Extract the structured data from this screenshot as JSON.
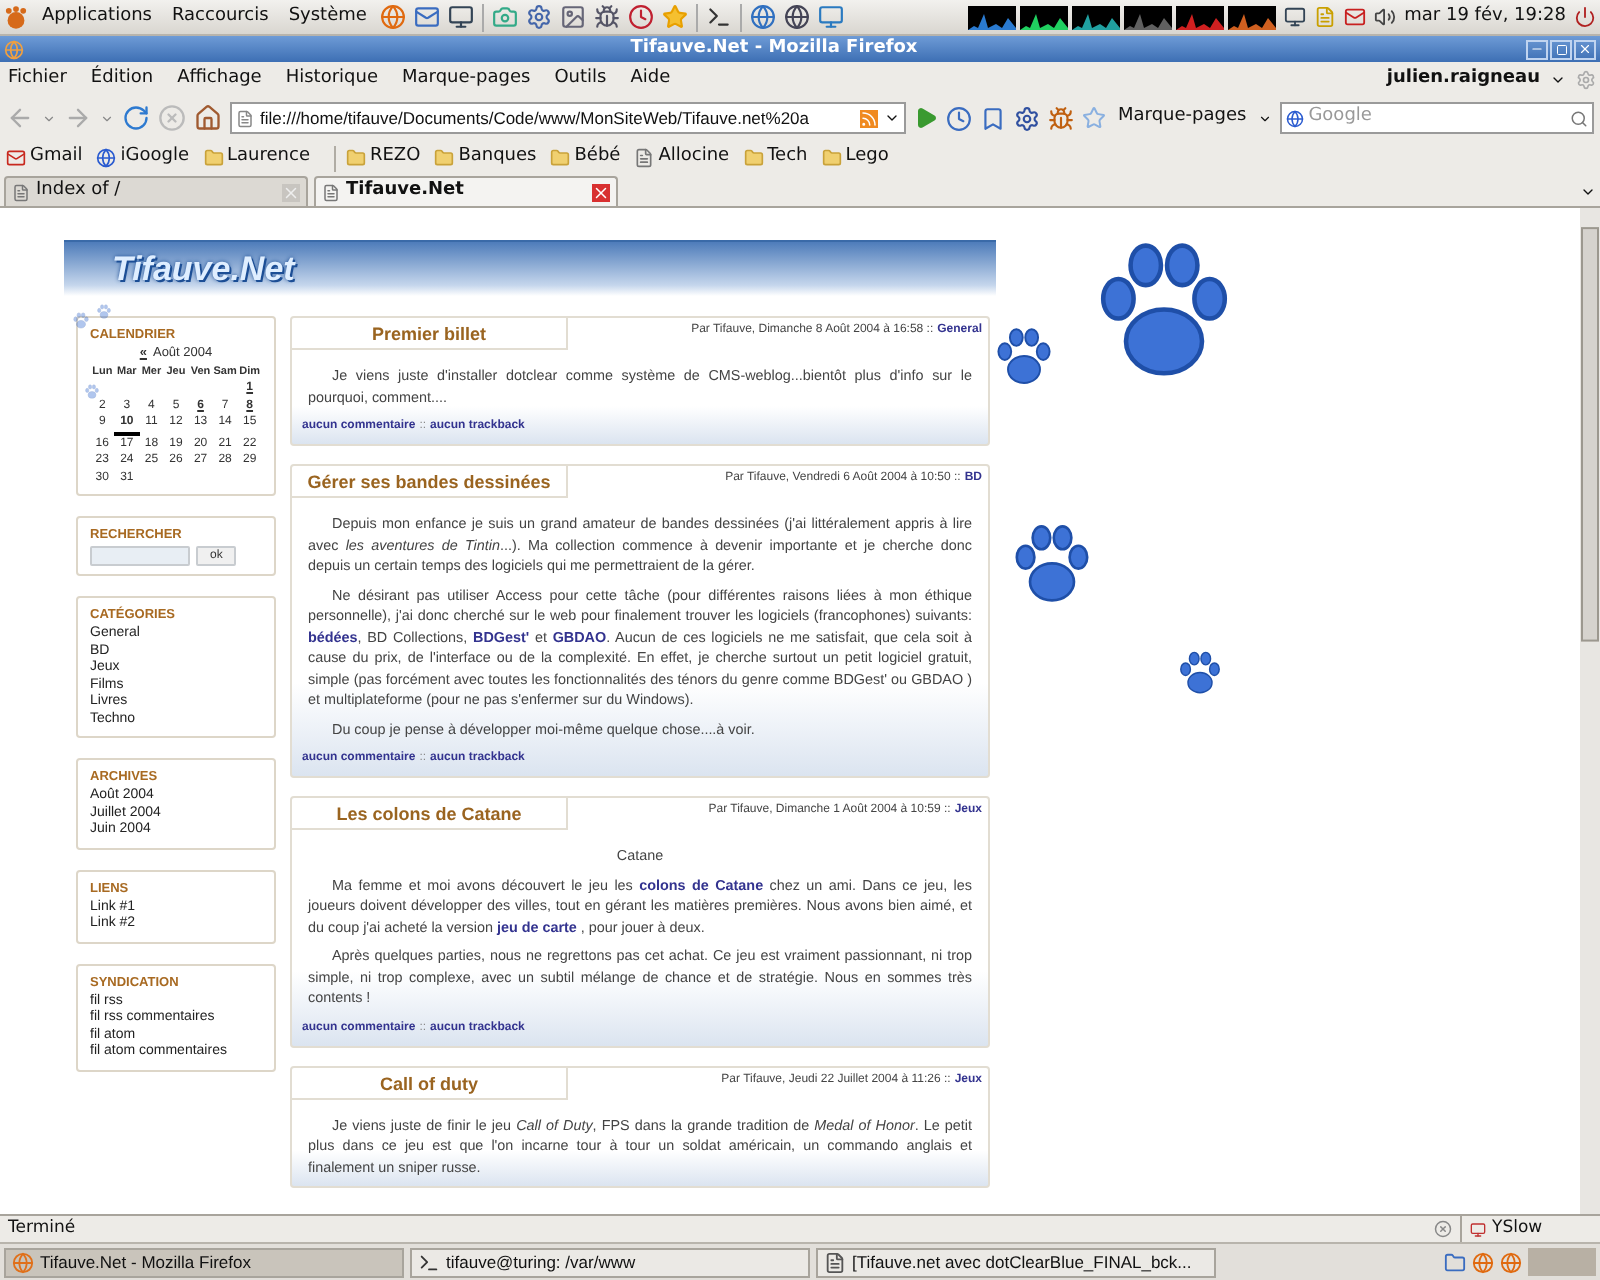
{
  "top_panel": {
    "menus": [
      "Applications",
      "Raccourcis",
      "Système"
    ],
    "clock": "mar 19 fév, 19:28"
  },
  "window": {
    "title": "Tifauve.Net - Mozilla Firefox"
  },
  "menubar": [
    "Fichier",
    "Édition",
    "Affichage",
    "Historique",
    "Marque-pages",
    "Outils",
    "Aide"
  ],
  "user": "julien.raigneau",
  "toolbar": {
    "url": "file:///home/tifauve/Documents/Code/www/MonSiteWeb/Tifauve.net%20a",
    "bookmarks_menu": "Marque-pages",
    "search": {
      "placeholder": "Google"
    }
  },
  "bookmark_groups": [
    {
      "items": [
        {
          "label": "Gmail",
          "kind": "mail"
        },
        {
          "label": "iGoogle",
          "kind": "google"
        },
        {
          "label": "Laurence",
          "kind": "folder"
        }
      ]
    },
    {
      "items": [
        {
          "label": "REZO",
          "kind": "folder"
        },
        {
          "label": "Banques",
          "kind": "folder"
        },
        {
          "label": "Bébé",
          "kind": "folder"
        },
        {
          "label": "Allocine",
          "kind": "page"
        },
        {
          "label": "Tech",
          "kind": "folder"
        },
        {
          "label": "Lego",
          "kind": "folder"
        }
      ]
    }
  ],
  "tabs": [
    {
      "label": "Index of /",
      "selected": false
    },
    {
      "label": "Tifauve.Net",
      "selected": true
    }
  ],
  "page": {
    "logo": "Tifauve.Net",
    "calendar": {
      "title": "CALENDRIER",
      "prev": "«",
      "month": "Août 2004",
      "weekdays": [
        "Lun",
        "Mar",
        "Mer",
        "Jeu",
        "Ven",
        "Sam",
        "Dim"
      ],
      "weeks": [
        [
          {
            "kind": "blank"
          },
          {
            "kind": "blank"
          },
          {
            "kind": "blank"
          },
          {
            "kind": "blank"
          },
          {
            "kind": "blank"
          },
          {
            "kind": "blank"
          },
          {
            "day": "1",
            "linked": true,
            "today": false
          }
        ],
        [
          {
            "day": "2",
            "linked": false,
            "today": false
          },
          {
            "day": "3",
            "linked": false,
            "today": false
          },
          {
            "day": "4",
            "linked": false,
            "today": false
          },
          {
            "day": "5",
            "linked": false,
            "today": false
          },
          {
            "day": "6",
            "linked": true,
            "today": false
          },
          {
            "day": "7",
            "linked": false,
            "today": false
          },
          {
            "day": "8",
            "linked": true,
            "today": false
          }
        ],
        [
          {
            "day": "9",
            "linked": false,
            "today": false
          },
          {
            "day": "10",
            "linked": false,
            "today": true
          },
          {
            "day": "11",
            "linked": false,
            "today": false
          },
          {
            "day": "12",
            "linked": false,
            "today": false
          },
          {
            "day": "13",
            "linked": false,
            "today": false
          },
          {
            "day": "14",
            "linked": false,
            "today": false
          },
          {
            "day": "15",
            "linked": false,
            "today": false
          }
        ],
        [
          {
            "day": "16",
            "linked": false,
            "today": false
          },
          {
            "day": "17",
            "linked": false,
            "today": false
          },
          {
            "day": "18",
            "linked": false,
            "today": false
          },
          {
            "day": "19",
            "linked": false,
            "today": false
          },
          {
            "day": "20",
            "linked": false,
            "today": false
          },
          {
            "day": "21",
            "linked": false,
            "today": false
          },
          {
            "day": "22",
            "linked": false,
            "today": false
          }
        ],
        [
          {
            "day": "23",
            "linked": false,
            "today": false
          },
          {
            "day": "24",
            "linked": false,
            "today": false
          },
          {
            "day": "25",
            "linked": false,
            "today": false
          },
          {
            "day": "26",
            "linked": false,
            "today": false
          },
          {
            "day": "27",
            "linked": false,
            "today": false
          },
          {
            "day": "28",
            "linked": false,
            "today": false
          },
          {
            "day": "29",
            "linked": false,
            "today": false
          }
        ],
        [
          {
            "day": "30",
            "linked": false,
            "today": false
          },
          {
            "day": "31",
            "linked": false,
            "today": false
          },
          {
            "kind": "blank"
          },
          {
            "kind": "blank"
          },
          {
            "kind": "blank"
          },
          {
            "kind": "blank"
          },
          {
            "kind": "blank"
          }
        ]
      ]
    },
    "search": {
      "title": "RECHERCHER",
      "button": "ok"
    },
    "blocks": [
      {
        "title": "CATÉGORIES",
        "links": [
          "General",
          "BD",
          "Jeux",
          "Films",
          "Livres",
          "Techno"
        ]
      },
      {
        "title": "ARCHIVES",
        "links": [
          "Août 2004",
          "Juillet 2004",
          "Juin 2004"
        ]
      },
      {
        "title": "LIENS",
        "links": [
          "Link #1",
          "Link #2"
        ]
      },
      {
        "title": "SYNDICATION",
        "links": [
          "fil rss",
          "fil rss commentaires",
          "fil atom",
          "fil atom commentaires"
        ]
      }
    ],
    "posts": [
      {
        "title": "Premier billet",
        "meta": "Par Tifauve, Dimanche 8 Août 2004 à 16:58 ::",
        "category": "General",
        "paragraphs": [
          {
            "kind": "text",
            "text": "Je viens juste d'installer dotclear comme système de CMS-weblog...bientôt plus d'info sur le pourquoi, comment...."
          }
        ],
        "comments": "aucun commentaire",
        "separator": "::",
        "trackbacks": "aucun trackback"
      },
      {
        "title": "Gérer ses bandes dessinées",
        "meta": "Par Tifauve, Vendredi 6 Août 2004 à 10:50 ::",
        "category": "BD",
        "paragraphs": [
          {
            "kind": "text",
            "text": "Depuis mon enfance je suis un grand amateur de bandes dessinées (j'ai littéralement appris à lire avec *les aventures de Tintin*...). Ma collection commence à devenir importante et je cherche donc depuis un certain temps des logiciels qui me permettraient de la gérer."
          },
          {
            "kind": "text",
            "text": "Ne désirant pas utiliser Access pour cette tâche (pour différentes raisons liées à mon éthique personnelle), j'ai donc cherché sur le web pour finalement trouver les logiciels (francophones) suivants: **bédées**, BD Collections, **BDGest'** et **GBDAO**. Aucun de ces logiciels ne me satisfait, que cela soit à cause du prix, de l'interface ou de la complexité. En effet, je cherche surtout un petit logiciel gratuit, simple (pas forcément avec toutes les fonctionnalités des ténors du genre comme BDGest' ou GBDAO ) et multiplateforme (pour ne pas s'enfermer sur du Windows)."
          },
          {
            "kind": "text",
            "text": "Du coup je pense à développer moi-même quelque chose....à voir."
          }
        ],
        "comments": "aucun commentaire",
        "separator": "::",
        "trackbacks": "aucun trackback"
      },
      {
        "title": "Les colons de Catane",
        "meta": "Par Tifauve, Dimanche 1 Août 2004 à 10:59 ::",
        "category": "Jeux",
        "paragraphs": [
          {
            "kind": "centered",
            "text": "Catane"
          },
          {
            "kind": "text",
            "text": "Ma femme et moi avons découvert le jeu les **colons de Catane** chez un ami. Dans ce jeu, les joueurs doivent développer des villes, tout en gérant les matières premières. Nous avons bien aimé, et du coup j'ai acheté la version **jeu de carte** , pour jouer à deux."
          },
          {
            "kind": "text",
            "text": "Après quelques parties, nous ne regrettons pas cet achat. Ce jeu est vraiment passionnant, ni trop simple, ni trop complexe, avec un subtil mélange de chance et de stratégie. Nous en sommes très contents !"
          }
        ],
        "comments": "aucun commentaire",
        "separator": "::",
        "trackbacks": "aucun trackback"
      },
      {
        "title": "Call of duty",
        "meta": "Par Tifauve, Jeudi 22 Juillet 2004 à 11:26 ::",
        "category": "Jeux",
        "paragraphs": [
          {
            "kind": "text",
            "text": "Je viens juste de finir le jeu *Call of Duty*, FPS dans la grande tradition de *Medal of Honor*. Le petit plus dans ce jeu est que l'on incarne tour à tour un soldat américain, un commando anglais et finalement un sniper russe."
          }
        ]
      }
    ]
  },
  "status_bar": {
    "text": "Terminé",
    "addon": "YSlow"
  },
  "taskbar": [
    {
      "label": "Tifauve.Net - Mozilla Firefox",
      "kind": "browser",
      "selected": true
    },
    {
      "label": "tifauve@turing: /var/www",
      "kind": "terminal",
      "selected": false
    },
    {
      "label": "[Tifauve.net avec dotClearBlue_FINAL_bck...",
      "kind": "document",
      "selected": false
    }
  ]
}
